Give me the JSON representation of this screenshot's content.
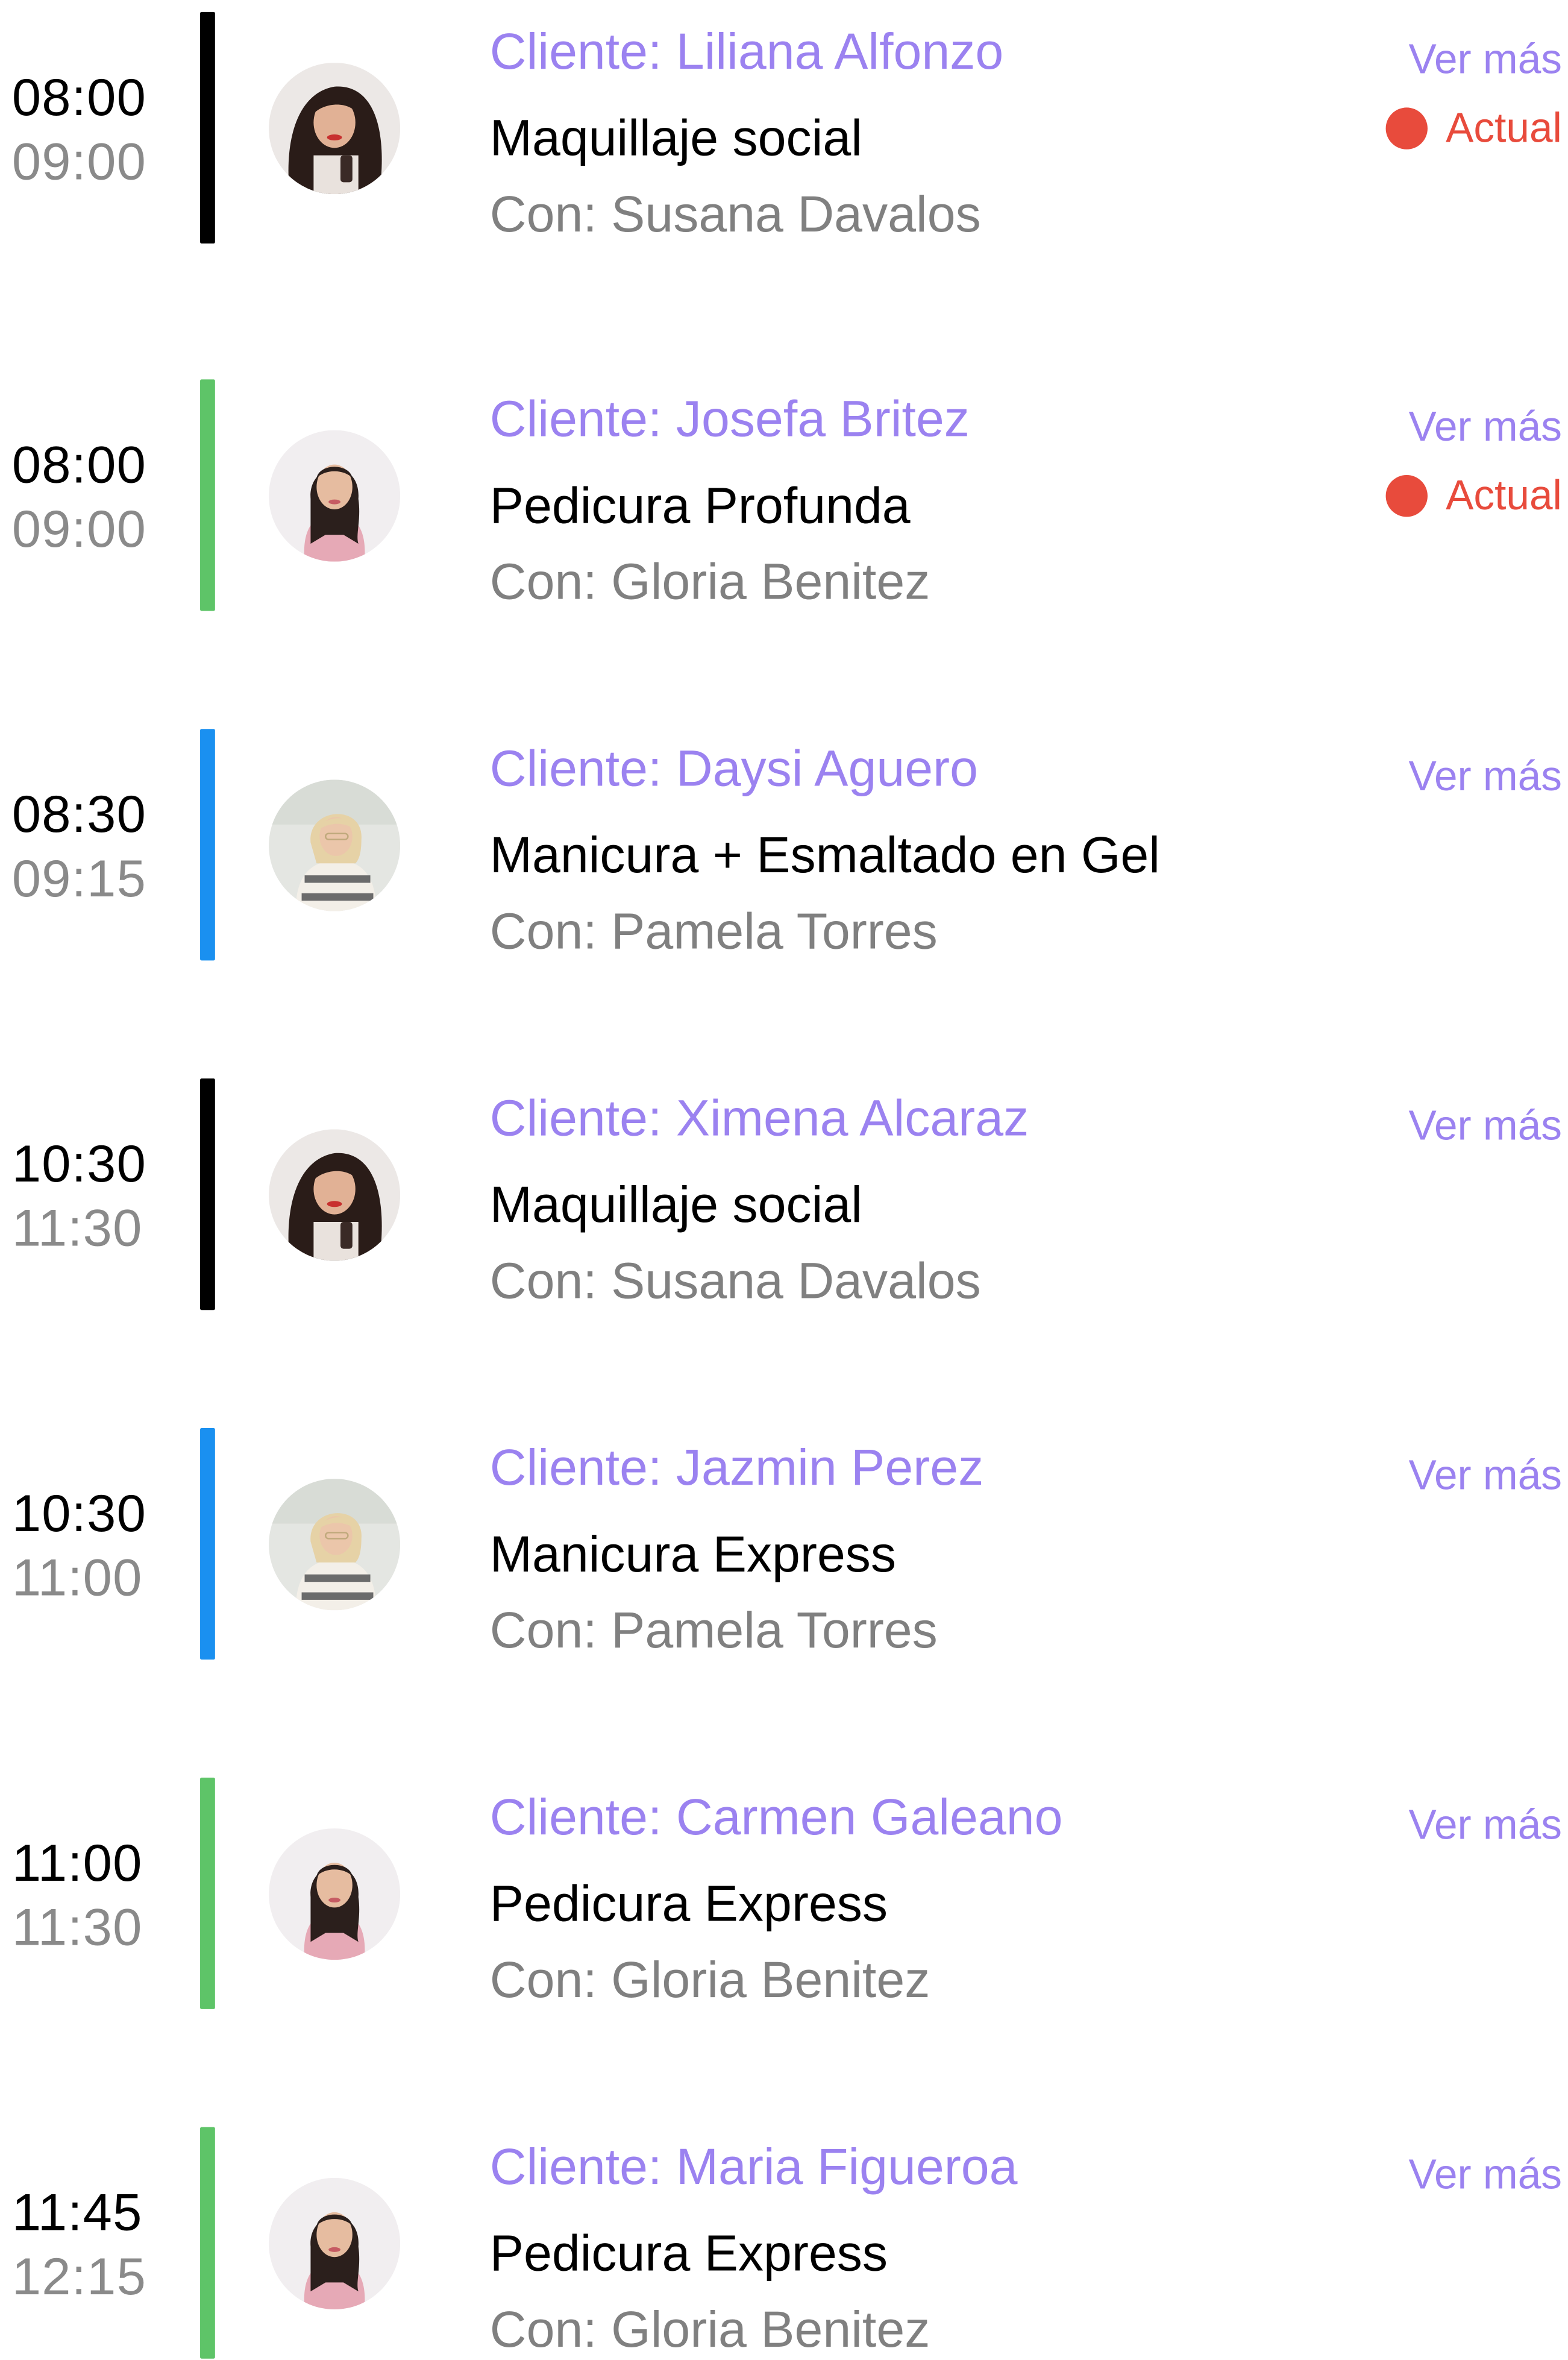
{
  "colors": {
    "accent": "#9b82f0",
    "status_red": "#e84b3c",
    "bar_black": "#000000",
    "bar_green": "#5ec468",
    "bar_blue": "#1a90f0"
  },
  "appointments": [
    {
      "start": "08:00",
      "end": "09:00",
      "bar_color": "#000000",
      "avatar": "stylist-susana",
      "client": "Cliente: Liliana Alfonzo",
      "service": "Maquillaje social",
      "staff": "Con: Susana Davalos",
      "more_label": "Ver más",
      "status_label": "Actual"
    },
    {
      "start": "08:00",
      "end": "09:00",
      "bar_color": "#5ec468",
      "avatar": "stylist-gloria",
      "client": "Cliente: Josefa Britez",
      "service": "Pedicura Profunda",
      "staff": "Con: Gloria Benitez",
      "more_label": "Ver más",
      "status_label": "Actual"
    },
    {
      "start": "08:30",
      "end": "09:15",
      "bar_color": "#1a90f0",
      "avatar": "stylist-pamela",
      "client": "Cliente: Daysi Aguero",
      "service": "Manicura + Esmaltado en Gel",
      "staff": "Con: Pamela Torres",
      "more_label": "Ver más"
    },
    {
      "start": "10:30",
      "end": "11:30",
      "bar_color": "#000000",
      "avatar": "stylist-susana",
      "client": "Cliente: Ximena Alcaraz",
      "service": "Maquillaje social",
      "staff": "Con: Susana Davalos",
      "more_label": "Ver más"
    },
    {
      "start": "10:30",
      "end": "11:00",
      "bar_color": "#1a90f0",
      "avatar": "stylist-pamela",
      "client": "Cliente: Jazmin Perez",
      "service": "Manicura Express",
      "staff": "Con: Pamela Torres",
      "more_label": "Ver más"
    },
    {
      "start": "11:00",
      "end": "11:30",
      "bar_color": "#5ec468",
      "avatar": "stylist-gloria",
      "client": "Cliente: Carmen Galeano",
      "service": "Pedicura Express",
      "staff": "Con: Gloria Benitez",
      "more_label": "Ver más"
    },
    {
      "start": "11:45",
      "end": "12:15",
      "bar_color": "#5ec468",
      "avatar": "stylist-gloria",
      "client": "Cliente: Maria Figueroa",
      "service": "Pedicura Express",
      "staff": "Con: Gloria Benitez",
      "more_label": "Ver más"
    }
  ]
}
